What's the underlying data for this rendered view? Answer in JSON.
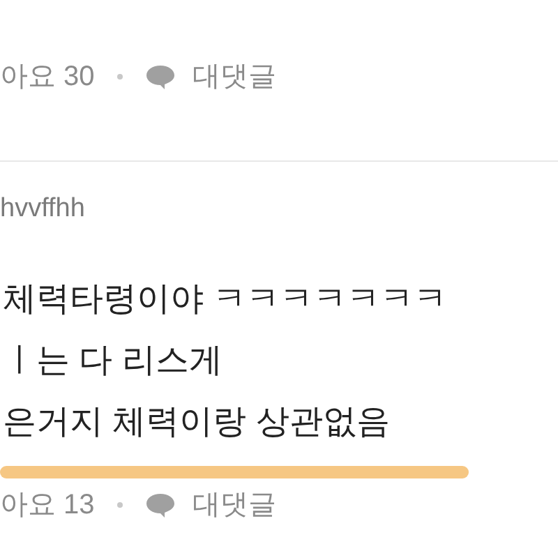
{
  "comments": [
    {
      "likes": "아요 30",
      "reply": "대댓글"
    },
    {
      "author": "hvvffhh",
      "lines": [
        {
          "text": "체력타령이야 ㅋㅋㅋㅋㅋㅋㅋ",
          "highlighted": false
        },
        {
          "text": "ㅣ는 다 리스게",
          "highlighted": false
        },
        {
          "text": "은거지 체력이랑 상관없음",
          "highlighted": true
        }
      ],
      "likes": "아요 13",
      "reply": "대댓글"
    }
  ]
}
